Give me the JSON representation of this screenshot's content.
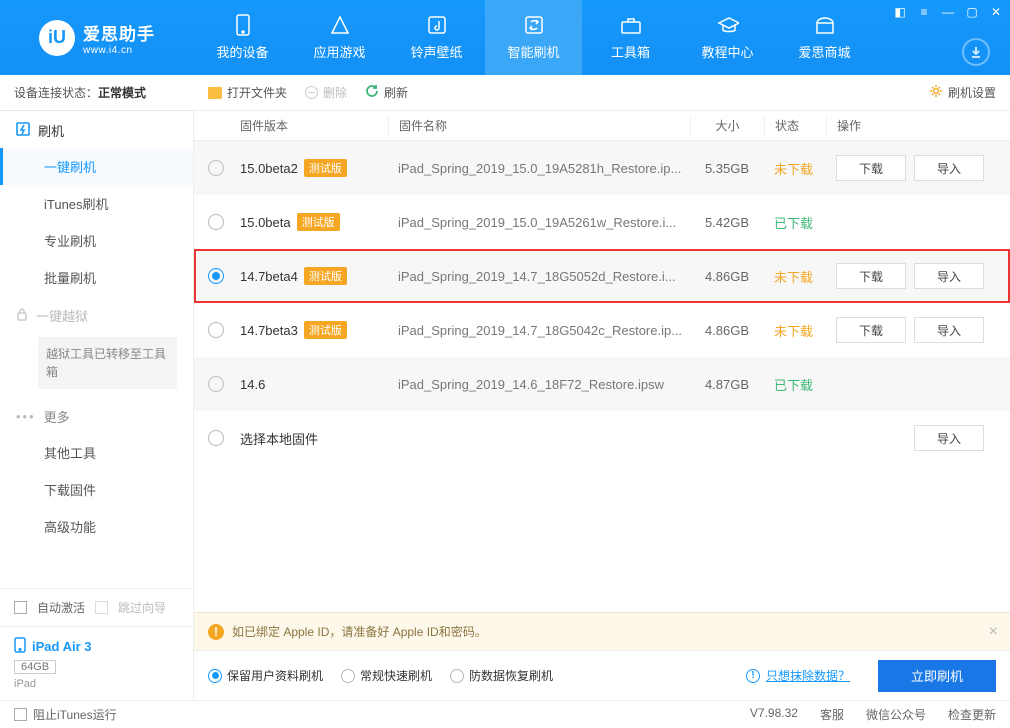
{
  "app": {
    "name": "爱思助手",
    "url": "www.i4.cn"
  },
  "nav": {
    "items": [
      {
        "label": "我的设备"
      },
      {
        "label": "应用游戏"
      },
      {
        "label": "铃声壁纸"
      },
      {
        "label": "智能刷机"
      },
      {
        "label": "工具箱"
      },
      {
        "label": "教程中心"
      },
      {
        "label": "爱思商城"
      }
    ]
  },
  "status": {
    "prefix": "设备连接状态：",
    "value": "正常模式"
  },
  "sidebar": {
    "group_flash": "刷机",
    "sub_oneclick": "一键刷机",
    "sub_itunes": "iTunes刷机",
    "sub_pro": "专业刷机",
    "sub_batch": "批量刷机",
    "group_jailbreak": "一键越狱",
    "note": "越狱工具已转移至工具箱",
    "group_more": "更多",
    "sub_other": "其他工具",
    "sub_download": "下载固件",
    "sub_advanced": "高级功能",
    "auto_activate": "自动激活",
    "skip_guide": "跳过向导",
    "device": {
      "name": "iPad Air 3",
      "capacity": "64GB",
      "type": "iPad"
    }
  },
  "toolbar": {
    "open": "打开文件夹",
    "delete": "删除",
    "refresh": "刷新",
    "settings": "刷机设置"
  },
  "columns": {
    "version": "固件版本",
    "name": "固件名称",
    "size": "大小",
    "status": "状态",
    "ops": "操作"
  },
  "badge_beta": "测试版",
  "status_labels": {
    "not_downloaded": "未下载",
    "downloaded": "已下载"
  },
  "op_labels": {
    "download": "下载",
    "import": "导入"
  },
  "rows": [
    {
      "version": "15.0beta2",
      "beta": true,
      "name": "iPad_Spring_2019_15.0_19A5281h_Restore.ip...",
      "size": "5.35GB",
      "status": "not_downloaded",
      "ops": [
        "download",
        "import"
      ],
      "selected": false
    },
    {
      "version": "15.0beta",
      "beta": true,
      "name": "iPad_Spring_2019_15.0_19A5261w_Restore.i...",
      "size": "5.42GB",
      "status": "downloaded",
      "ops": [],
      "selected": false
    },
    {
      "version": "14.7beta4",
      "beta": true,
      "name": "iPad_Spring_2019_14.7_18G5052d_Restore.i...",
      "size": "4.86GB",
      "status": "not_downloaded",
      "ops": [
        "download",
        "import"
      ],
      "selected": true,
      "highlight": true
    },
    {
      "version": "14.7beta3",
      "beta": true,
      "name": "iPad_Spring_2019_14.7_18G5042c_Restore.ip...",
      "size": "4.86GB",
      "status": "not_downloaded",
      "ops": [
        "download",
        "import"
      ],
      "selected": false
    },
    {
      "version": "14.6",
      "beta": false,
      "name": "iPad_Spring_2019_14.6_18F72_Restore.ipsw",
      "size": "4.87GB",
      "status": "downloaded",
      "ops": [],
      "selected": false
    }
  ],
  "local_row": "选择本地固件",
  "warning": "如已绑定 Apple ID，请准备好 Apple ID和密码。",
  "bottom": {
    "opt_keep": "保留用户资料刷机",
    "opt_normal": "常规快速刷机",
    "opt_anti": "防数据恢复刷机",
    "erase_link": "只想抹除数据？",
    "primary": "立即刷机"
  },
  "footer": {
    "block_itunes": "阻止iTunes运行",
    "version": "V7.98.32",
    "service": "客服",
    "wechat": "微信公众号",
    "update": "检查更新"
  }
}
